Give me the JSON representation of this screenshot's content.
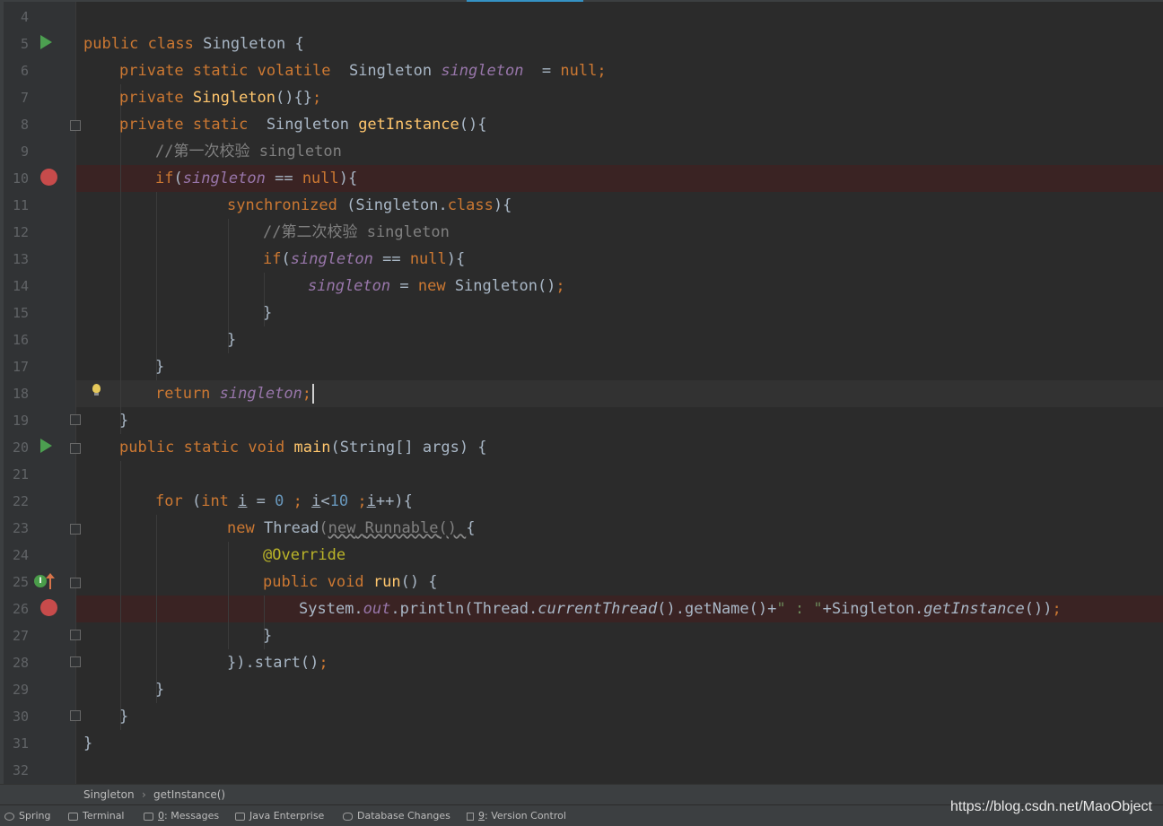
{
  "editor": {
    "line_numbers": [
      "4",
      "5",
      "6",
      "7",
      "8",
      "9",
      "10",
      "11",
      "12",
      "13",
      "14",
      "15",
      "16",
      "17",
      "18",
      "19",
      "20",
      "21",
      "22",
      "23",
      "24",
      "25",
      "26",
      "27",
      "28",
      "29",
      "30",
      "31",
      "32"
    ],
    "tokens": {
      "public": "public",
      "class": "class",
      "private": "private",
      "static": "static",
      "volatile": "volatile",
      "null": "null",
      "if": "if",
      "return": "return",
      "void": "void",
      "for": "for",
      "int": "int",
      "new": "new",
      "synchronized": "synchronized",
      "class_kw": "class",
      "Singleton": "Singleton",
      "singleton": "singleton",
      "getInstance": "getInstance",
      "main": "main",
      "run": "run",
      "Thread": "Thread",
      "Runnable": "Runnable",
      "Override": "@Override",
      "String_args": "String[] args",
      "System": "System",
      "out": "out",
      "println": "println",
      "currentThread": "currentThread",
      "getName": "getName",
      "start": "start",
      "i": "i",
      "zero": "0",
      "ten": "10",
      "str_colon": "\" : \"",
      "comment1": "//第一次校验 singleton",
      "comment2": "//第二次校验 singleton"
    }
  },
  "breadcrumb": {
    "class_name": "Singleton",
    "method_name": "getInstance()"
  },
  "statusbar": {
    "spring": "Spring",
    "terminal": "Terminal",
    "messages_num": "0",
    "messages": ": Messages",
    "java_enterprise": "Java Enterprise",
    "database_changes": "Database Changes",
    "vc_num": "9",
    "version_control": ": Version Control"
  },
  "watermark": "https://blog.csdn.net/MaoObject",
  "colors": {
    "background": "#2b2b2b",
    "keyword": "#cc7832",
    "field": "#9876aa",
    "method": "#ffc66d",
    "comment": "#808080",
    "number": "#6897bb",
    "string": "#6a8759",
    "annotation": "#bbb529",
    "breakpoint": "#c74b4b",
    "run_marker": "#4c9f50"
  }
}
